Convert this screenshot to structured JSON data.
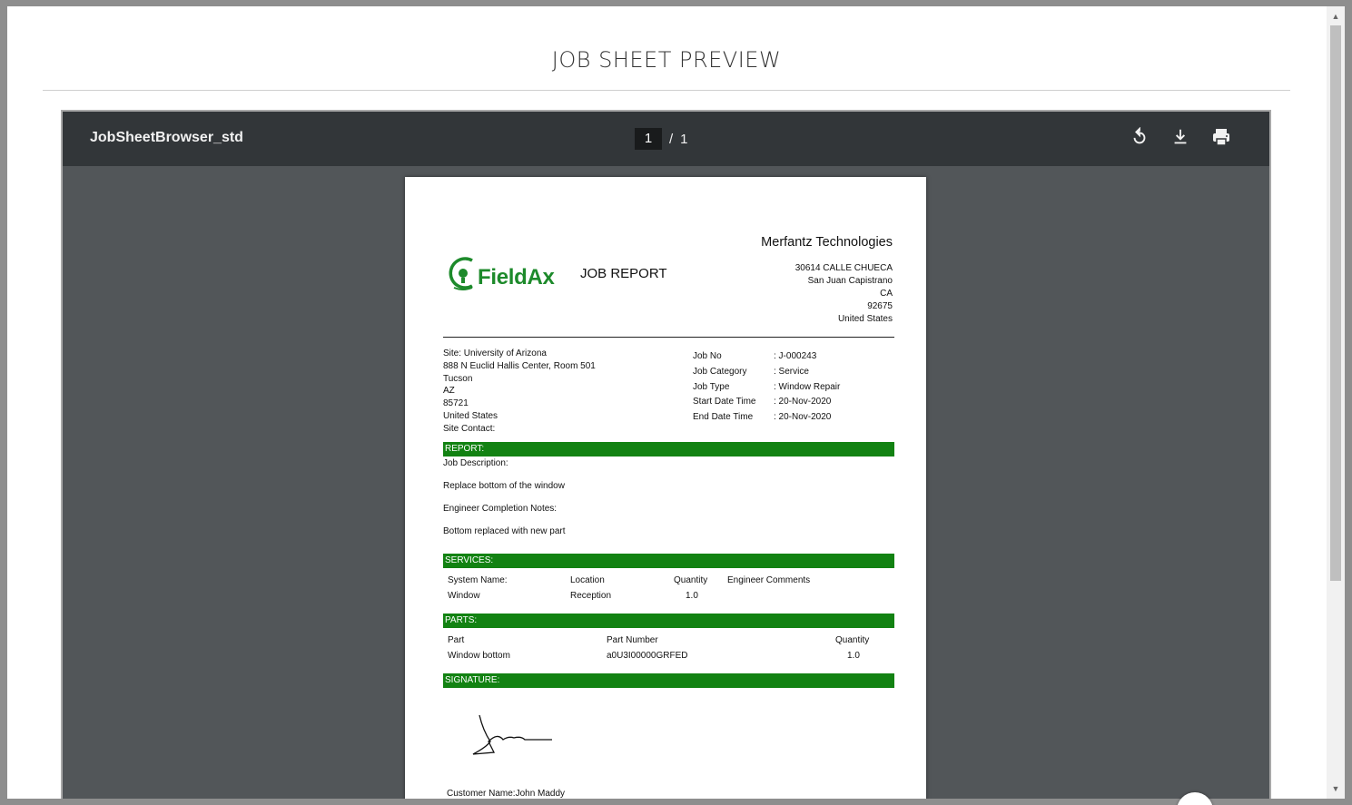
{
  "modal": {
    "title": "JOB SHEET PREVIEW"
  },
  "viewer": {
    "filename": "JobSheetBrowser_std",
    "page_current": "1",
    "page_separator": "/",
    "page_total": "1"
  },
  "report": {
    "logo_text": "FieldAx",
    "title": "JOB REPORT",
    "company": {
      "name": "Merfantz Technologies",
      "address_lines": [
        "30614 CALLE CHUECA",
        "San Juan Capistrano",
        "CA",
        "92675",
        "United States"
      ]
    },
    "site_lines": [
      "Site: University of Arizona",
      "888 N Euclid Hallis Center, Room 501",
      "Tucson",
      "AZ",
      "85721",
      "United States",
      "Site Contact:"
    ],
    "job_fields": [
      {
        "label": "Job No",
        "value": ": J-000243"
      },
      {
        "label": "Job Category",
        "value": ": Service"
      },
      {
        "label": "Job Type",
        "value": ": Window Repair"
      },
      {
        "label": "Start Date Time",
        "value": ": 20-Nov-2020"
      },
      {
        "label": "End Date Time",
        "value": ": 20-Nov-2020"
      }
    ],
    "report_section": {
      "header": "REPORT:",
      "lines": [
        "Job Description:",
        "Replace bottom of the window",
        "Engineer Completion Notes:",
        "Bottom replaced with new part"
      ]
    },
    "services": {
      "header": "SERVICES:",
      "columns": [
        "System Name:",
        "Location",
        "Quantity",
        "Engineer Comments"
      ],
      "rows": [
        [
          "Window",
          "Reception",
          "1.0",
          ""
        ]
      ]
    },
    "parts": {
      "header": "PARTS:",
      "columns": [
        "Part",
        "Part Number",
        "Quantity"
      ],
      "rows": [
        [
          "Window bottom",
          "a0U3I00000GRFED",
          "1.0"
        ]
      ]
    },
    "signature": {
      "header": "SIGNATURE:",
      "customer_name": "Customer Name:John Maddy"
    }
  },
  "colors": {
    "section_green": "#128212",
    "logo_green": "#1d8a2b",
    "toolbar": "#323639",
    "viewer_bg": "#525659"
  },
  "icons": [
    "rotate-icon",
    "download-icon",
    "print-icon"
  ]
}
